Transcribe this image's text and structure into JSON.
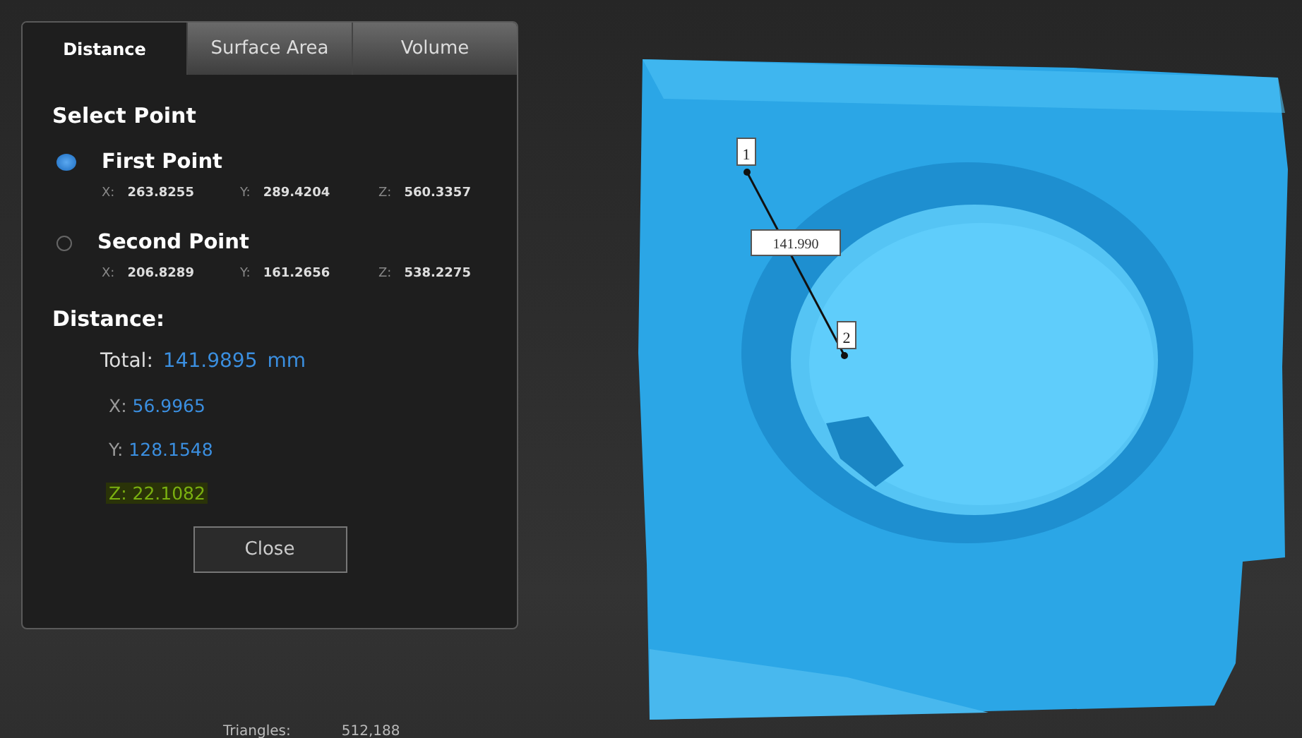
{
  "tabs": [
    {
      "label": "Distance",
      "selected": true
    },
    {
      "label": "Surface Area",
      "selected": false
    },
    {
      "label": "Volume",
      "selected": false
    }
  ],
  "section_title": "Select Point",
  "points": [
    {
      "label": "First Point",
      "selected": true,
      "coords": [
        {
          "axis": "X:",
          "value": "263.8255"
        },
        {
          "axis": "Y:",
          "value": "289.4204"
        },
        {
          "axis": "Z:",
          "value": "560.3357"
        }
      ]
    },
    {
      "label": "Second Point",
      "selected": false,
      "coords": [
        {
          "axis": "X:",
          "value": "206.8289"
        },
        {
          "axis": "Y:",
          "value": "161.2656"
        },
        {
          "axis": "Z:",
          "value": "538.2275"
        }
      ]
    }
  ],
  "distance": {
    "heading": "Distance:",
    "total_label": "Total:",
    "total_value": "141.9895",
    "unit": "mm",
    "components": [
      {
        "axis": "X:",
        "value": "56.9965",
        "highlighted": false
      },
      {
        "axis": "Y:",
        "value": "128.1548",
        "highlighted": false
      },
      {
        "axis": "Z:",
        "value": "22.1082",
        "highlighted": true
      }
    ]
  },
  "close_button": "Close",
  "scene": {
    "point_labels": [
      "1",
      "2"
    ],
    "measurement": "141.990"
  },
  "status_bar": {
    "label": "Triangles:",
    "value": "512,188"
  }
}
